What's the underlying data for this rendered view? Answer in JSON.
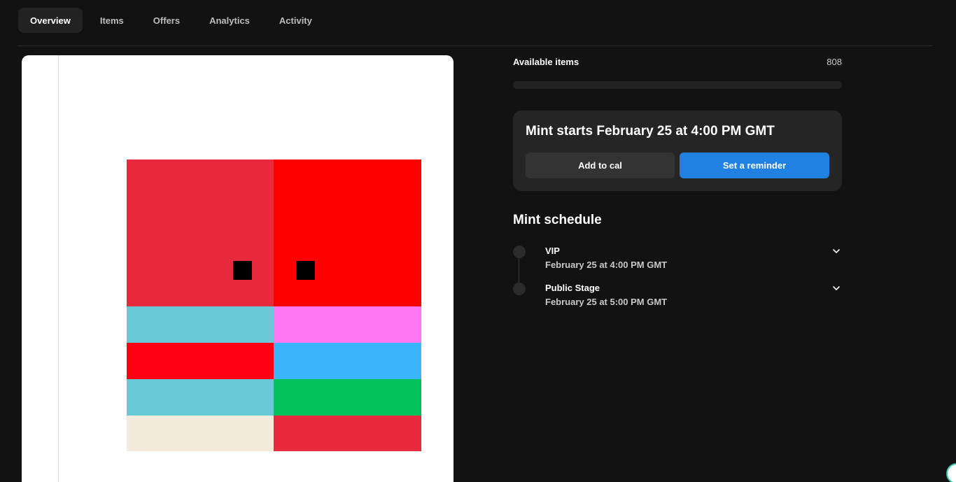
{
  "tabs": [
    {
      "label": "Overview",
      "active": true
    },
    {
      "label": "Items",
      "active": false
    },
    {
      "label": "Offers",
      "active": false
    },
    {
      "label": "Analytics",
      "active": false
    },
    {
      "label": "Activity",
      "active": false
    }
  ],
  "available": {
    "label": "Available items",
    "count": "808",
    "progress_fraction": 0
  },
  "mint": {
    "title": "Mint starts February 25 at 4:00 PM GMT",
    "add_to_cal_label": "Add to cal",
    "reminder_label": "Set a reminder"
  },
  "schedule": {
    "title": "Mint schedule",
    "stages": [
      {
        "name": "VIP",
        "time": "February 25 at 4:00 PM GMT"
      },
      {
        "name": "Public Stage",
        "time": "February 25 at 5:00 PM GMT"
      }
    ]
  },
  "artwork": {
    "colors": {
      "top_left": "#e82a3e",
      "top_right": "#ff0000",
      "eyes": "#000000",
      "row1_left": "#6ac9d6",
      "row1_right": "#ff77f3",
      "row2_left": "#ff0013",
      "row2_right": "#3bb5fb",
      "row3_left": "#6ac9d6",
      "row3_right": "#00c15a",
      "row4_left": "#f4ebdd",
      "row4_right": "#e82a3e"
    }
  },
  "icons": {
    "chevron": "chevron-down-icon",
    "badge": "app-badge-icon"
  },
  "theme": {
    "accent": "#2081e2",
    "background": "#121212",
    "card": "#252525"
  }
}
